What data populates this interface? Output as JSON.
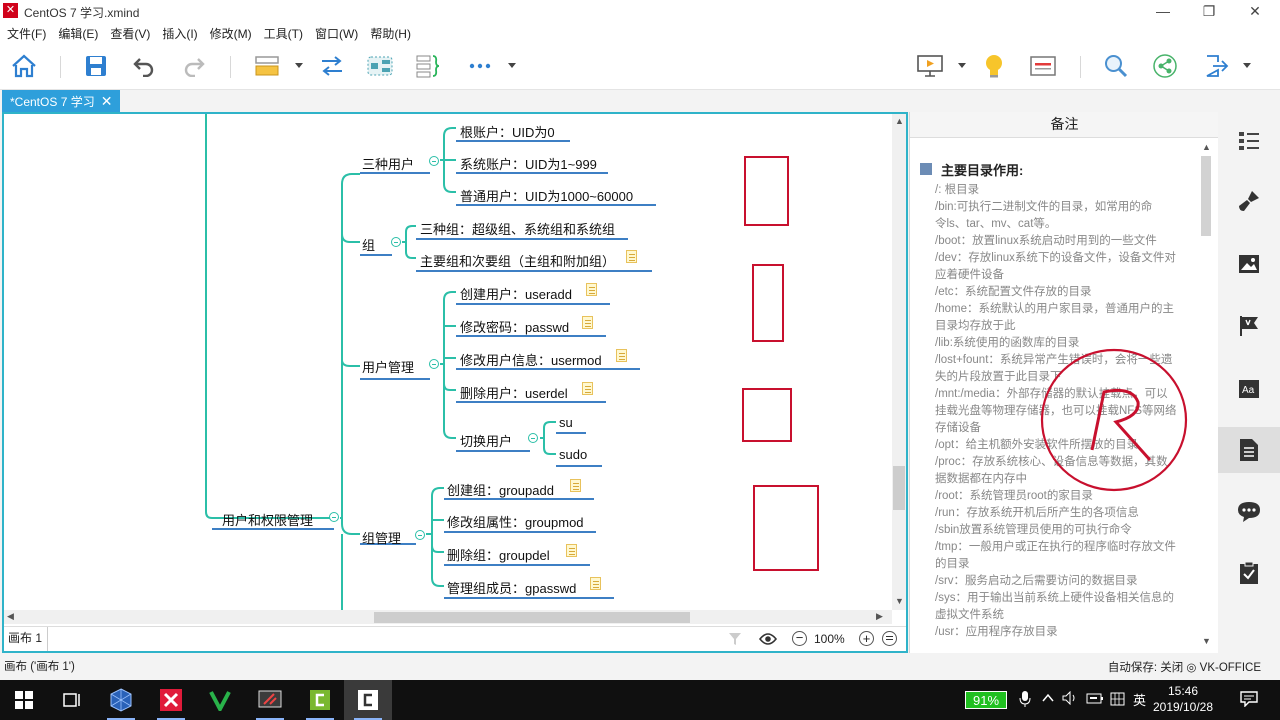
{
  "window": {
    "title": "CentOS 7 学习.xmind",
    "minimize_glyph": "—",
    "restore_glyph": "❐",
    "close_glyph": "✕"
  },
  "menu": [
    "文件(F)",
    "编辑(E)",
    "查看(V)",
    "插入(I)",
    "修改(M)",
    "工具(T)",
    "窗口(W)",
    "帮助(H)"
  ],
  "toolbar": {
    "icons": [
      "home-icon",
      "save-icon",
      "undo-icon",
      "redo-icon",
      "topic-icon",
      "relationship-icon",
      "boundary-icon",
      "summary-icon",
      "more-icon",
      "presentation-icon",
      "idea-icon",
      "theme-icon",
      "search-icon",
      "share-icon",
      "export-icon"
    ]
  },
  "tab": {
    "label": "*CentOS 7 学习",
    "close": "✕"
  },
  "mindmap": {
    "central": "用户和权限管理",
    "groups": [
      {
        "label": "三种用户",
        "children": [
          "根账户：UID为0",
          "系统账户：UID为1~999",
          "普通用户：UID为1000~60000"
        ]
      },
      {
        "label": "组",
        "children": [
          "三种组：超级组、系统组和系统组",
          "主要组和次要组（主组和附加组）"
        ]
      },
      {
        "label": "用户管理",
        "children": [
          "创建用户：useradd",
          "修改密码：passwd",
          "修改用户信息：usermod",
          "删除用户：userdel",
          "切换用户"
        ]
      },
      {
        "label": "组管理",
        "children": [
          "创建组：groupadd",
          "修改组属性：groupmod",
          "删除组：groupdel",
          "管理组成员：gpasswd"
        ]
      }
    ],
    "switch_user_children": [
      "su",
      "sudo"
    ]
  },
  "sheetbar": {
    "sheet_name": "画布 1",
    "zoom": "100%",
    "minus": "−",
    "plus": "+"
  },
  "notes": {
    "header": "备注",
    "title": "主要目录作用:",
    "lines": [
      "/:  根目录",
      "/bin:可执行二进制文件的目录，如常用的命",
      "令ls、tar、mv、cat等。",
      "/boot：放置linux系统启动时用到的一些文件",
      "/dev：存放linux系统下的设备文件，设备文件对",
      "应着硬件设备",
      "/etc：系统配置文件存放的目录",
      "/home：系统默认的用户家目录，普通用户的主",
      "目录均存放于此",
      "/lib:系统使用的函数库的目录",
      "/lost+fount：系统异常产生错误时，会将一些遗",
      "失的片段放置于此目录下",
      "/mnt:/media：外部存储器的默认挂载点，可以",
      "挂载光盘等物理存储器，也可以挂载NFS等网络",
      "存储设备",
      "/opt：给主机额外安装软件所摆放的目录",
      "/proc：存放系统核心、设备信息等数据，其数",
      "据数据都在内存中",
      "/root：系统管理员root的家目录",
      "/run：存放系统开机后所产生的各项信息",
      "/sbin放置系统管理员使用的可执行命令",
      "/tmp：一般用户或正在执行的程序临时存放文件",
      "的目录",
      "/srv：服务启动之后需要访问的数据目录",
      "/sys：用于输出当前系统上硬件设备相关信息的",
      "虚拟文件系统",
      "/usr：应用程序存放目录"
    ]
  },
  "rail_icons": [
    "outline-icon",
    "format-brush-icon",
    "image-icon",
    "marker-flag-icon",
    "text-style-icon",
    "notes-icon",
    "comments-icon",
    "task-icon"
  ],
  "status": {
    "left": "画布 ('画布 1')",
    "right": "自动保存: 关闭  ◎ VK-OFFICE"
  },
  "taskbar": {
    "battery": "91%",
    "ime": "英",
    "time": "15:46",
    "date": "2019/10/28"
  },
  "colors": {
    "accent": "#2e9fdb",
    "branch": "#2bbfa8",
    "underline": "#3d7fc4",
    "annotation": "#c8102e"
  }
}
